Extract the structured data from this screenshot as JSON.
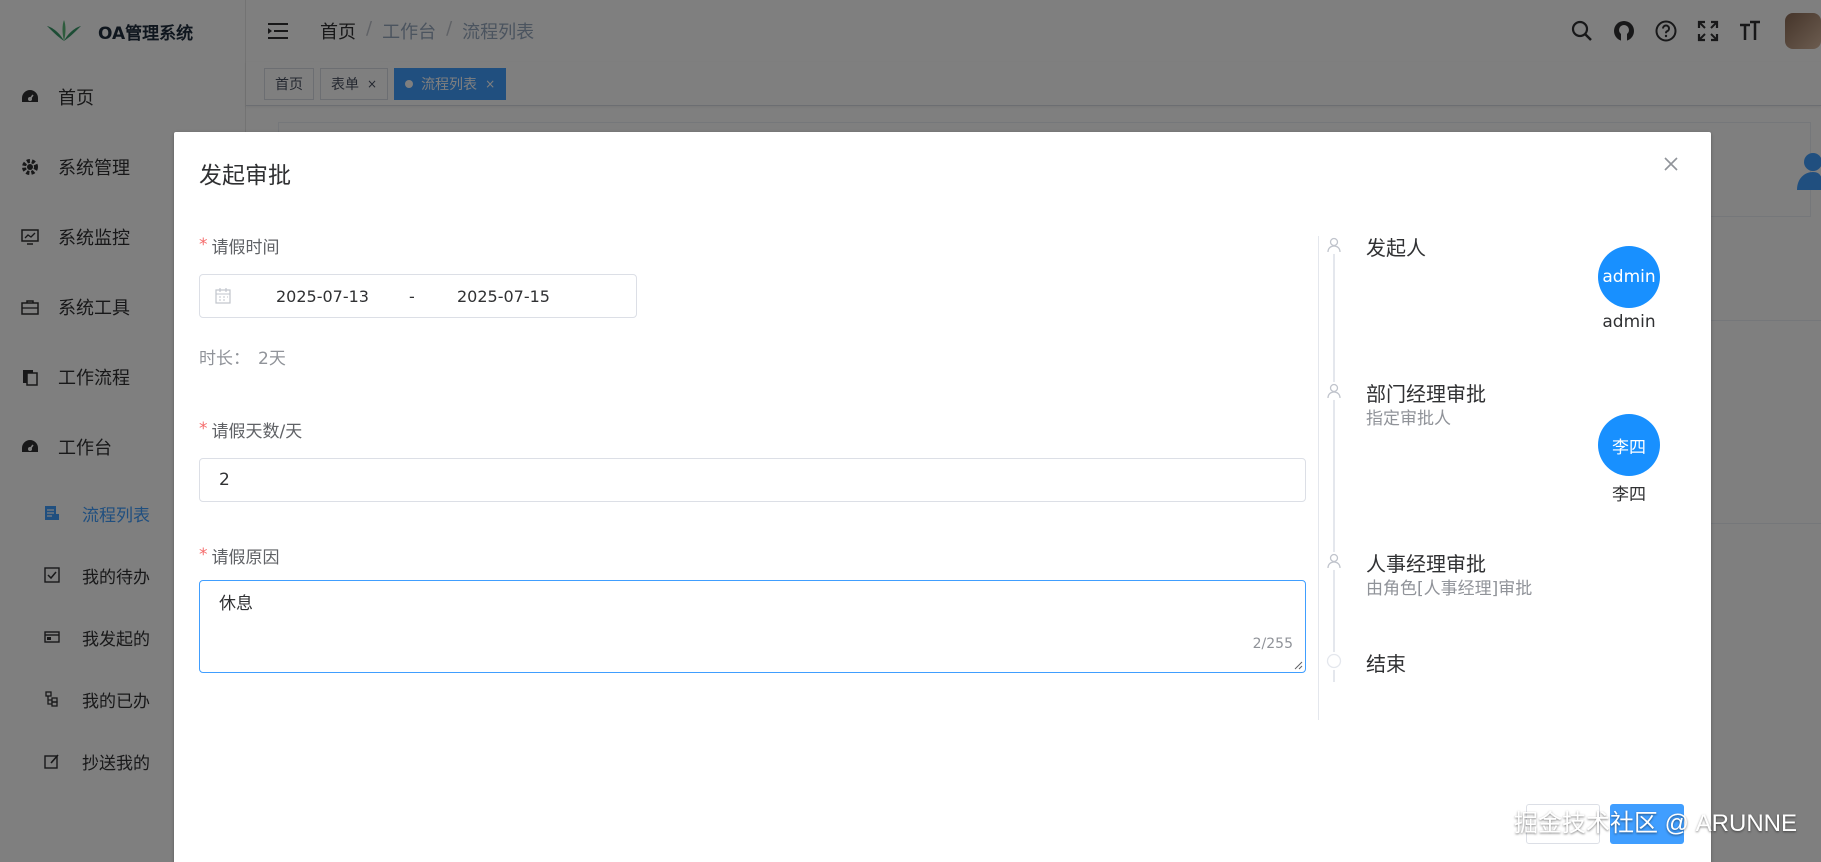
{
  "app": {
    "title": "OA管理系统"
  },
  "sidebar": {
    "items": [
      {
        "label": "首页",
        "icon": "dashboard-icon"
      },
      {
        "label": "系统管理",
        "icon": "gear-icon"
      },
      {
        "label": "系统监控",
        "icon": "monitor-icon"
      },
      {
        "label": "系统工具",
        "icon": "toolbox-icon"
      },
      {
        "label": "工作流程",
        "icon": "documents-icon"
      },
      {
        "label": "工作台",
        "icon": "dashboard-icon"
      }
    ],
    "subitems": [
      {
        "label": "流程列表",
        "icon": "list-icon",
        "active": true
      },
      {
        "label": "我的待办",
        "icon": "checkbox-icon"
      },
      {
        "label": "我发起的",
        "icon": "card-icon"
      },
      {
        "label": "我的已办",
        "icon": "tree-icon"
      },
      {
        "label": "抄送我的",
        "icon": "edit-icon"
      }
    ]
  },
  "header": {
    "breadcrumb": [
      "首页",
      "工作台",
      "流程列表"
    ]
  },
  "tags": [
    {
      "label": "首页",
      "active": false,
      "closable": false
    },
    {
      "label": "表单",
      "active": false,
      "closable": true
    },
    {
      "label": "流程列表",
      "active": true,
      "closable": true
    }
  ],
  "dialog": {
    "title": "发起审批",
    "form": {
      "leave_time_label": "请假时间",
      "start_date": "2025-07-13",
      "range_separator": "-",
      "end_date": "2025-07-15",
      "duration_label": "时长：",
      "duration_value": "2天",
      "days_label": "请假天数/天",
      "days_value": "2",
      "reason_label": "请假原因",
      "reason_value": "休息",
      "reason_count": "2/255"
    },
    "timeline": [
      {
        "title": "发起人",
        "sub": "",
        "avatar": "admin",
        "avatar_name": "admin"
      },
      {
        "title": "部门经理审批",
        "sub": "指定审批人",
        "avatar": "李四",
        "avatar_name": "李四"
      },
      {
        "title": "人事经理审批",
        "sub": "由角色[人事经理]审批",
        "avatar": "",
        "avatar_name": ""
      },
      {
        "title": "结束",
        "sub": "",
        "avatar": "",
        "avatar_name": ""
      }
    ]
  },
  "watermark": "掘金技术社区 @ ARUNNE",
  "colors": {
    "primary": "#409eff",
    "avatar": "#1890ff",
    "required": "#f56c6c"
  }
}
